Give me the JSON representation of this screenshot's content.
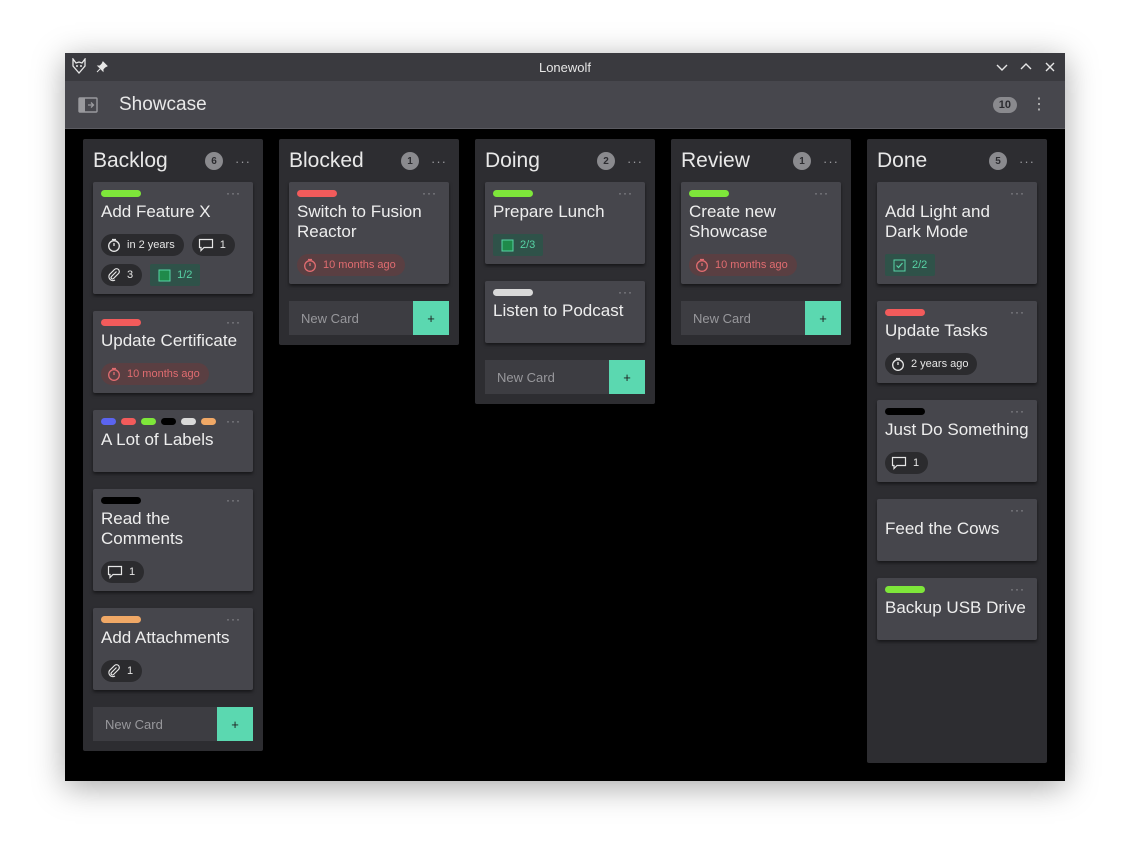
{
  "window": {
    "title": "Lonewolf"
  },
  "header": {
    "board_title": "Showcase",
    "count": "10"
  },
  "colors": {
    "green": "#7ee63a",
    "red": "#f25b5b",
    "blue": "#5b64f0",
    "black": "#000000",
    "white": "#d9d9d9",
    "orange": "#f0a866",
    "accent": "#5bd8b0"
  },
  "new_card_placeholder": "New Card",
  "add_button": "+",
  "lists": [
    {
      "title": "Backlog",
      "count": "6",
      "cards": [
        {
          "title": "Add Feature X",
          "labels": [
            "green"
          ],
          "badges": [
            {
              "type": "due",
              "text": "in 2 years"
            },
            {
              "type": "comments",
              "text": "1"
            },
            {
              "type": "attachments",
              "text": "3"
            },
            {
              "type": "checklist",
              "text": "1/2"
            }
          ]
        },
        {
          "title": "Update Certificate",
          "labels": [
            "red"
          ],
          "badges": [
            {
              "type": "overdue",
              "text": "10 months ago"
            }
          ]
        },
        {
          "title": "A Lot of Labels",
          "labels": [
            "blue",
            "red",
            "green",
            "black",
            "white",
            "orange"
          ],
          "badges": []
        },
        {
          "title": "Read the Comments",
          "labels": [
            "black"
          ],
          "badges": [
            {
              "type": "comments",
              "text": "1"
            }
          ]
        },
        {
          "title": "Add Attachments",
          "labels": [
            "orange"
          ],
          "badges": [
            {
              "type": "attachments",
              "text": "1"
            }
          ]
        }
      ]
    },
    {
      "title": "Blocked",
      "count": "1",
      "cards": [
        {
          "title": "Switch to Fusion Reactor",
          "labels": [
            "red"
          ],
          "badges": [
            {
              "type": "overdue",
              "text": "10 months ago"
            }
          ]
        }
      ]
    },
    {
      "title": "Doing",
      "count": "2",
      "cards": [
        {
          "title": "Prepare Lunch",
          "labels": [
            "green"
          ],
          "badges": [
            {
              "type": "checklist",
              "text": "2/3"
            }
          ]
        },
        {
          "title": "Listen to Podcast",
          "labels": [
            "white"
          ],
          "badges": []
        }
      ]
    },
    {
      "title": "Review",
      "count": "1",
      "cards": [
        {
          "title": "Create new Showcase",
          "labels": [
            "green"
          ],
          "badges": [
            {
              "type": "overdue",
              "text": "10 months ago"
            }
          ]
        }
      ]
    },
    {
      "title": "Done",
      "count": "5",
      "cards": [
        {
          "title": "Add Light and Dark Mode",
          "labels": [],
          "badges": [
            {
              "type": "checklist-done",
              "text": "2/2"
            }
          ]
        },
        {
          "title": "Update Tasks",
          "labels": [
            "red"
          ],
          "badges": [
            {
              "type": "due",
              "text": "2 years ago"
            }
          ]
        },
        {
          "title": "Just Do Something",
          "labels": [
            "black"
          ],
          "badges": [
            {
              "type": "comments",
              "text": "1"
            }
          ]
        },
        {
          "title": "Feed the Cows",
          "labels": [],
          "badges": []
        },
        {
          "title": "Backup USB Drive",
          "labels": [
            "green"
          ],
          "badges": []
        }
      ]
    }
  ]
}
